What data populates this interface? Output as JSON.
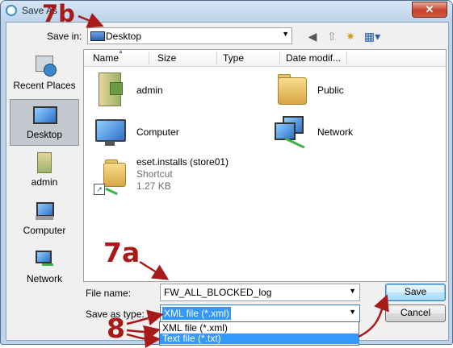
{
  "window": {
    "title": "Save As",
    "close_glyph": "✕"
  },
  "save_in": {
    "label": "Save in:",
    "value": "Desktop",
    "icons": [
      "back-icon",
      "up-folder-icon",
      "new-folder-icon",
      "views-menu-icon"
    ]
  },
  "places": [
    {
      "label": "Recent Places",
      "icon": "recent-places-icon"
    },
    {
      "label": "Desktop",
      "icon": "desktop-icon",
      "selected": true
    },
    {
      "label": "admin",
      "icon": "user-folder-icon"
    },
    {
      "label": "Computer",
      "icon": "computer-icon"
    },
    {
      "label": "Network",
      "icon": "network-icon"
    }
  ],
  "columns": [
    "Name",
    "Size",
    "Type",
    "Date modif..."
  ],
  "items": [
    {
      "name": "admin",
      "icon": "user-folder-icon"
    },
    {
      "name": "Public",
      "icon": "folder-icon"
    },
    {
      "name": "Computer",
      "icon": "computer-icon"
    },
    {
      "name": "Network",
      "icon": "network-icon"
    },
    {
      "name": "eset.installs (store01)",
      "type": "Shortcut",
      "size": "1.27 KB",
      "icon": "shortcut-folder-icon"
    }
  ],
  "file_name": {
    "label": "File name:",
    "value": "FW_ALL_BLOCKED_log"
  },
  "save_type": {
    "label": "Save as type:",
    "value": "XML file (*.xml)",
    "options": [
      "XML file (*.xml)",
      "Text file (*.txt)"
    ],
    "highlighted_option": "Text file (*.txt)"
  },
  "buttons": {
    "save": "Save",
    "cancel": "Cancel"
  },
  "annotations": {
    "a": "7a",
    "b": "7b",
    "c": "8"
  },
  "colors": {
    "annotation": "#a61a1a",
    "highlight": "#3399ff",
    "selected_place": "#c3c8ce"
  }
}
